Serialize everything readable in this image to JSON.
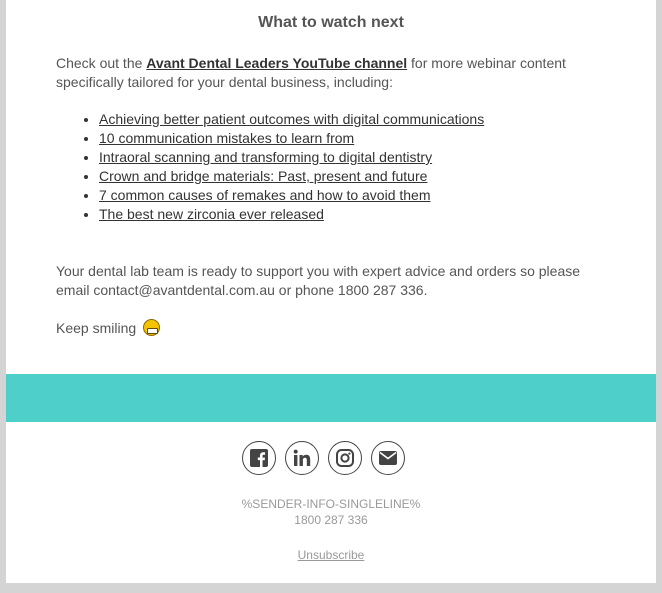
{
  "email": {
    "title": "What to watch next",
    "intro_before": "Check out the ",
    "intro_link": "Avant Dental Leaders YouTube channel",
    "intro_after": " for more webinar content specifically tailored for your dental business, including:",
    "links": [
      "Achieving better patient outcomes with digital communications",
      "10 communication mistakes to learn from",
      "Intraoral scanning and transforming to digital dentistry",
      "Crown and bridge materials: Past, present and future",
      "7 common causes of remakes and how to avoid them",
      "The best new zirconia ever released"
    ],
    "support_text": "Your dental lab team is ready to support you with expert advice and orders so please email contact@avantdental.com.au or phone 1800 287 336.",
    "signoff": "Keep smiling",
    "signoff_emoji": "grinning-face-icon"
  },
  "colors": {
    "band": "#4ecfca",
    "text": "#555555",
    "footer_text": "#999999"
  },
  "footer": {
    "social": [
      "facebook-icon",
      "linkedin-icon",
      "instagram-icon",
      "email-icon"
    ],
    "sender_info": "%SENDER-INFO-SINGLELINE%",
    "phone": "1800 287 336",
    "unsubscribe": "Unsubscribe"
  }
}
